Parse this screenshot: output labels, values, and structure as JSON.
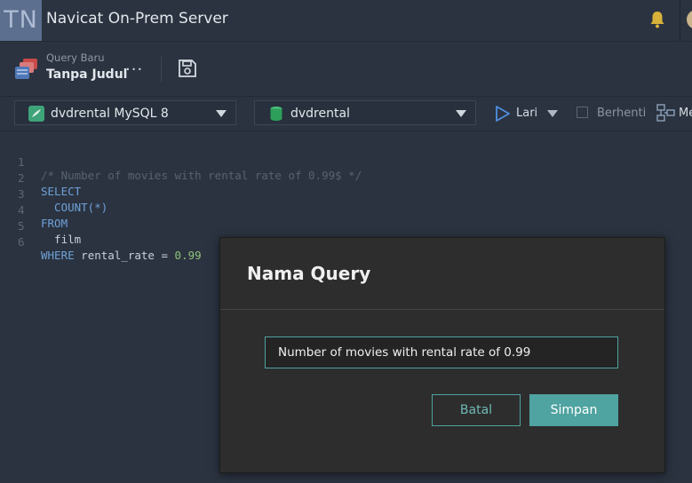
{
  "app": {
    "logo_text": "TN",
    "title": "Navicat On-Prem Server"
  },
  "query_tab": {
    "subtitle": "Query Baru",
    "name": "Tanpa Judul",
    "more_label": "···"
  },
  "toolbar": {
    "connection": "dvdrental MySQL 8",
    "database": "dvdrental",
    "run_label": "Lari",
    "stop_label": "Berhenti",
    "model_label": "Me"
  },
  "editor": {
    "lines": [
      {
        "num": "1",
        "text": "/* Number of movies with rental rate of 0.99$ */"
      },
      {
        "num": "2",
        "text": "SELECT"
      },
      {
        "num": "3",
        "text": "  COUNT(*)"
      },
      {
        "num": "4",
        "text": "FROM"
      },
      {
        "num": "5",
        "text": "  film"
      },
      {
        "num": "6",
        "text": "WHERE rental_rate = 0.99"
      }
    ]
  },
  "modal": {
    "title": "Nama Query",
    "input_value": "Number of movies with rental rate of 0.99",
    "cancel_label": "Batal",
    "save_label": "Simpan"
  },
  "colors": {
    "accent": "#4fa3a0",
    "keyword": "#6ea0d8",
    "number": "#8fc27a",
    "comment": "#576272"
  }
}
